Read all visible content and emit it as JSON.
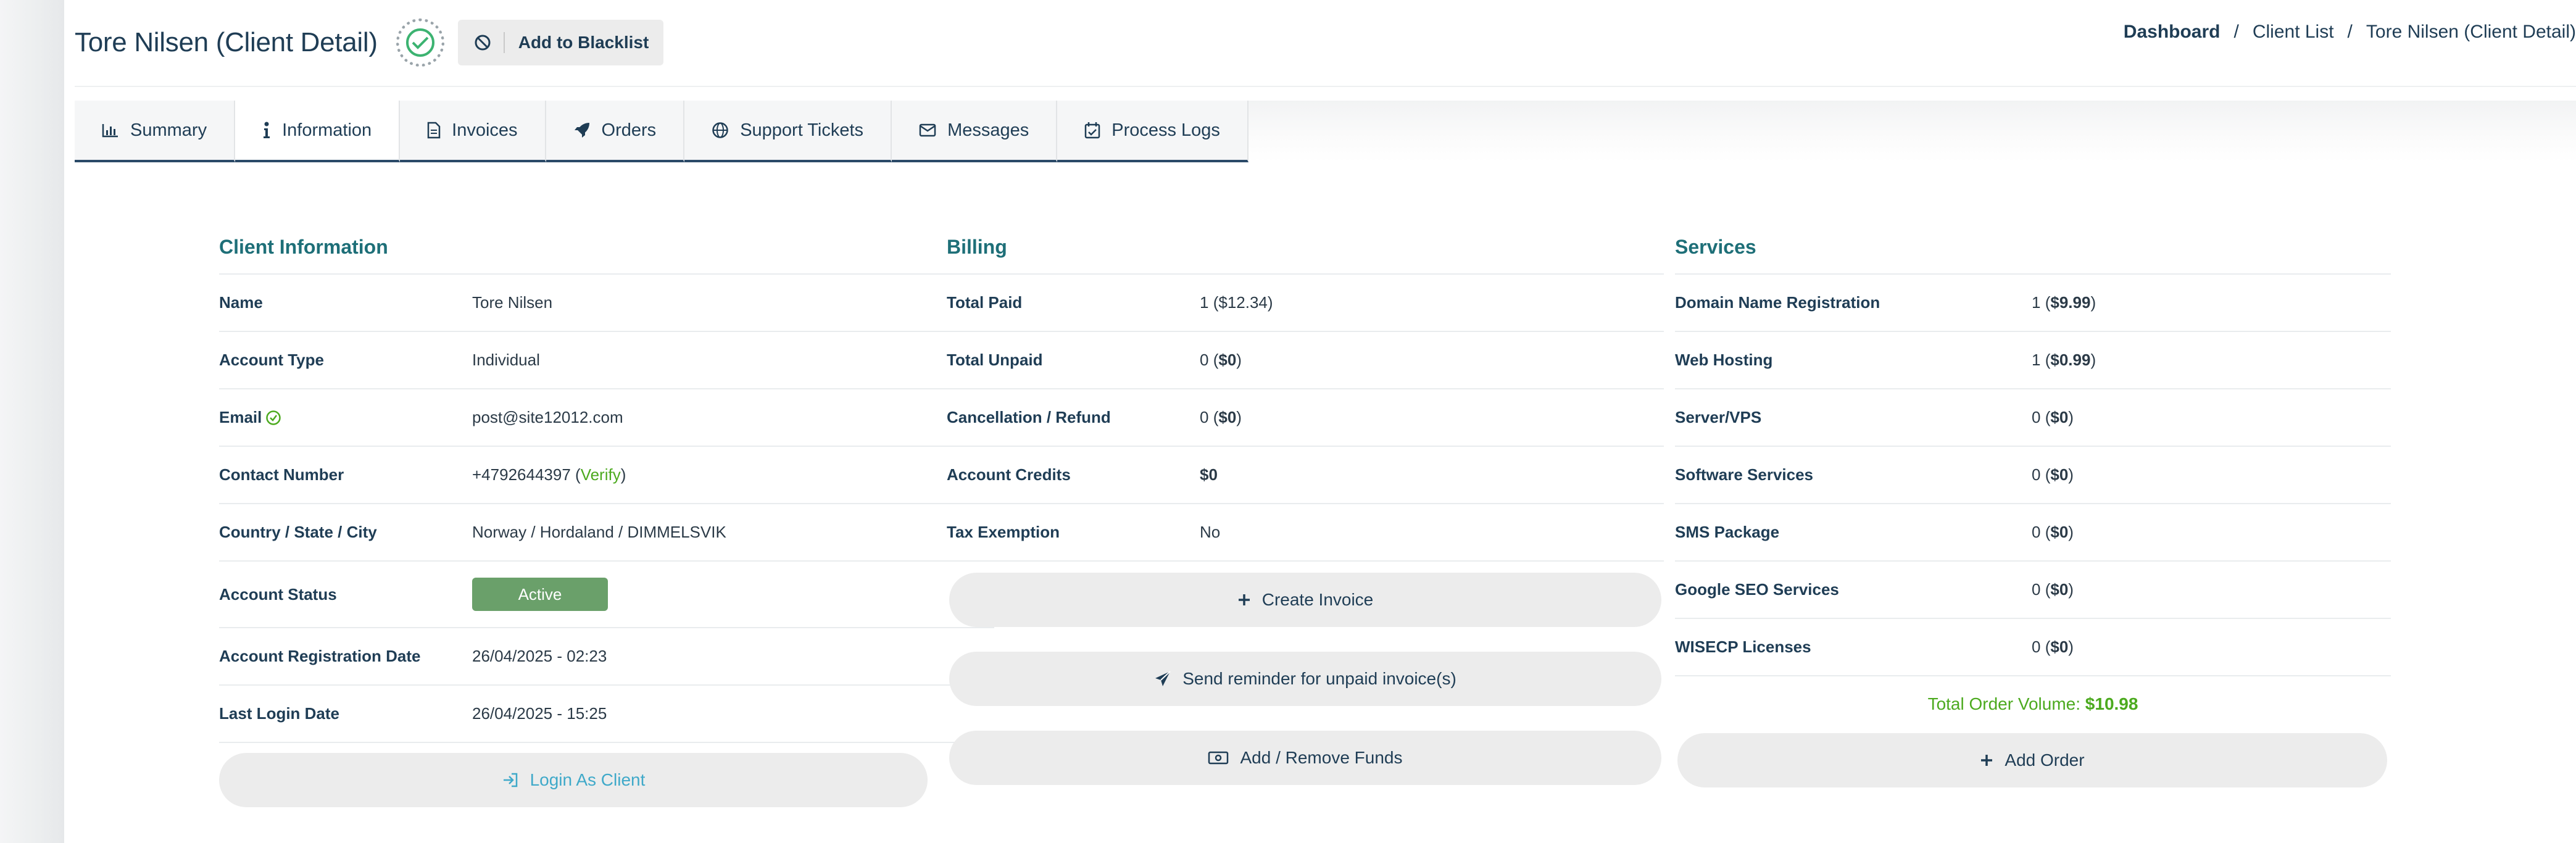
{
  "header": {
    "title": "Tore Nilsen (Client Detail)",
    "blacklist_label": "Add to Blacklist",
    "breadcrumb": [
      "Dashboard",
      "Client List",
      "Tore Nilsen (Client Detail)"
    ]
  },
  "tabs": [
    {
      "label": "Summary",
      "icon": "chart-icon"
    },
    {
      "label": "Information",
      "icon": "info-icon"
    },
    {
      "label": "Invoices",
      "icon": "document-icon"
    },
    {
      "label": "Orders",
      "icon": "rocket-icon"
    },
    {
      "label": "Support Tickets",
      "icon": "globe-icon"
    },
    {
      "label": "Messages",
      "icon": "envelope-icon"
    },
    {
      "label": "Process Logs",
      "icon": "calendar-check-icon"
    }
  ],
  "active_tab": "Information",
  "client_info": {
    "title": "Client Information",
    "rows": [
      {
        "label": "Name",
        "value": "Tore Nilsen"
      },
      {
        "label": "Account Type",
        "value": "Individual"
      },
      {
        "label": "Email",
        "value": "post@site12012.com"
      },
      {
        "label": "Contact Number",
        "value": "+4792644397",
        "verify": "Verify"
      },
      {
        "label": "Country / State / City",
        "value": "Norway / Hordaland / DIMMELSVIK"
      },
      {
        "label": "Account Status",
        "value": "Active"
      },
      {
        "label": "Account Registration Date",
        "value": "26/04/2025 - 02:23"
      },
      {
        "label": "Last Login Date",
        "value": "26/04/2025 - 15:25"
      }
    ],
    "login_button": "Login As Client"
  },
  "billing": {
    "title": "Billing",
    "rows": [
      {
        "label": "Total Paid",
        "count": "1",
        "amount": "$12.34"
      },
      {
        "label": "Total Unpaid",
        "count": "0",
        "amount": "$0"
      },
      {
        "label": "Cancellation / Refund",
        "count": "0",
        "amount": "$0"
      },
      {
        "label": "Account Credits",
        "value": "$0"
      },
      {
        "label": "Tax Exemption",
        "value": "No"
      }
    ],
    "buttons": [
      "Create Invoice",
      "Send reminder for unpaid invoice(s)",
      "Add / Remove Funds"
    ]
  },
  "services": {
    "title": "Services",
    "rows": [
      {
        "label": "Domain Name Registration",
        "count": "1",
        "amount": "$9.99"
      },
      {
        "label": "Web Hosting",
        "count": "1",
        "amount": "$0.99"
      },
      {
        "label": "Server/VPS",
        "count": "0",
        "amount": "$0"
      },
      {
        "label": "Software Services",
        "count": "0",
        "amount": "$0"
      },
      {
        "label": "SMS Package",
        "count": "0",
        "amount": "$0"
      },
      {
        "label": "Google SEO Services",
        "count": "0",
        "amount": "$0"
      },
      {
        "label": "WISECP Licenses",
        "count": "0",
        "amount": "$0"
      }
    ],
    "total_label": "Total Order Volume:",
    "total_value": "$10.98",
    "add_order": "Add Order"
  },
  "colors": {
    "accent": "#1e6f78",
    "navy": "#1f3d55",
    "paid_green": "#4caa1f",
    "unpaid_red": "#e53b2c",
    "active_badge": "#6aa06a",
    "login_blue": "#3fa9c9"
  }
}
